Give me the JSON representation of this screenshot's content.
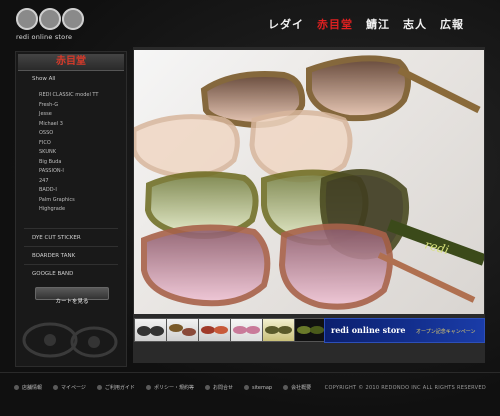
{
  "brand": {
    "logo_text": "redi online store"
  },
  "nav": {
    "items": [
      {
        "label": "レダイ",
        "active": false
      },
      {
        "label": "赤目堂",
        "active": true
      },
      {
        "label": "鯖江",
        "active": false
      },
      {
        "label": "志人",
        "active": false
      },
      {
        "label": "広報",
        "active": false
      }
    ]
  },
  "sidebar": {
    "heading": "赤目堂",
    "show_all": "Show All",
    "models": [
      "REDI CLASSIC model TT",
      "Fresh-G",
      "Jesse",
      "Michael 3",
      "OSSO",
      "FICO",
      "SKUNK",
      "Big Buda",
      "PASSION-I",
      "247",
      "BADD-I",
      "Palm Graphics",
      "Highgrade"
    ],
    "links": [
      "DYE CUT STICKER",
      "BOARDER TANK",
      "GOOGLE BAND"
    ],
    "cart_button": "カートを見る"
  },
  "banner": {
    "title": "redi online store",
    "subtitle": "オープン記念キャンペーン"
  },
  "footer": {
    "links": [
      "店舗情報",
      "マイページ",
      "ご利用ガイド",
      "ポリシー・規約等",
      "お問合せ",
      "sitemap",
      "会社概要"
    ],
    "copyright": "COPYRIGHT © 2010 REDONDO INC ALL RIGHTS RESERVED"
  },
  "colors": {
    "accent": "#e02020",
    "background": "#0d0d0d",
    "banner": "#1a3ca8"
  }
}
